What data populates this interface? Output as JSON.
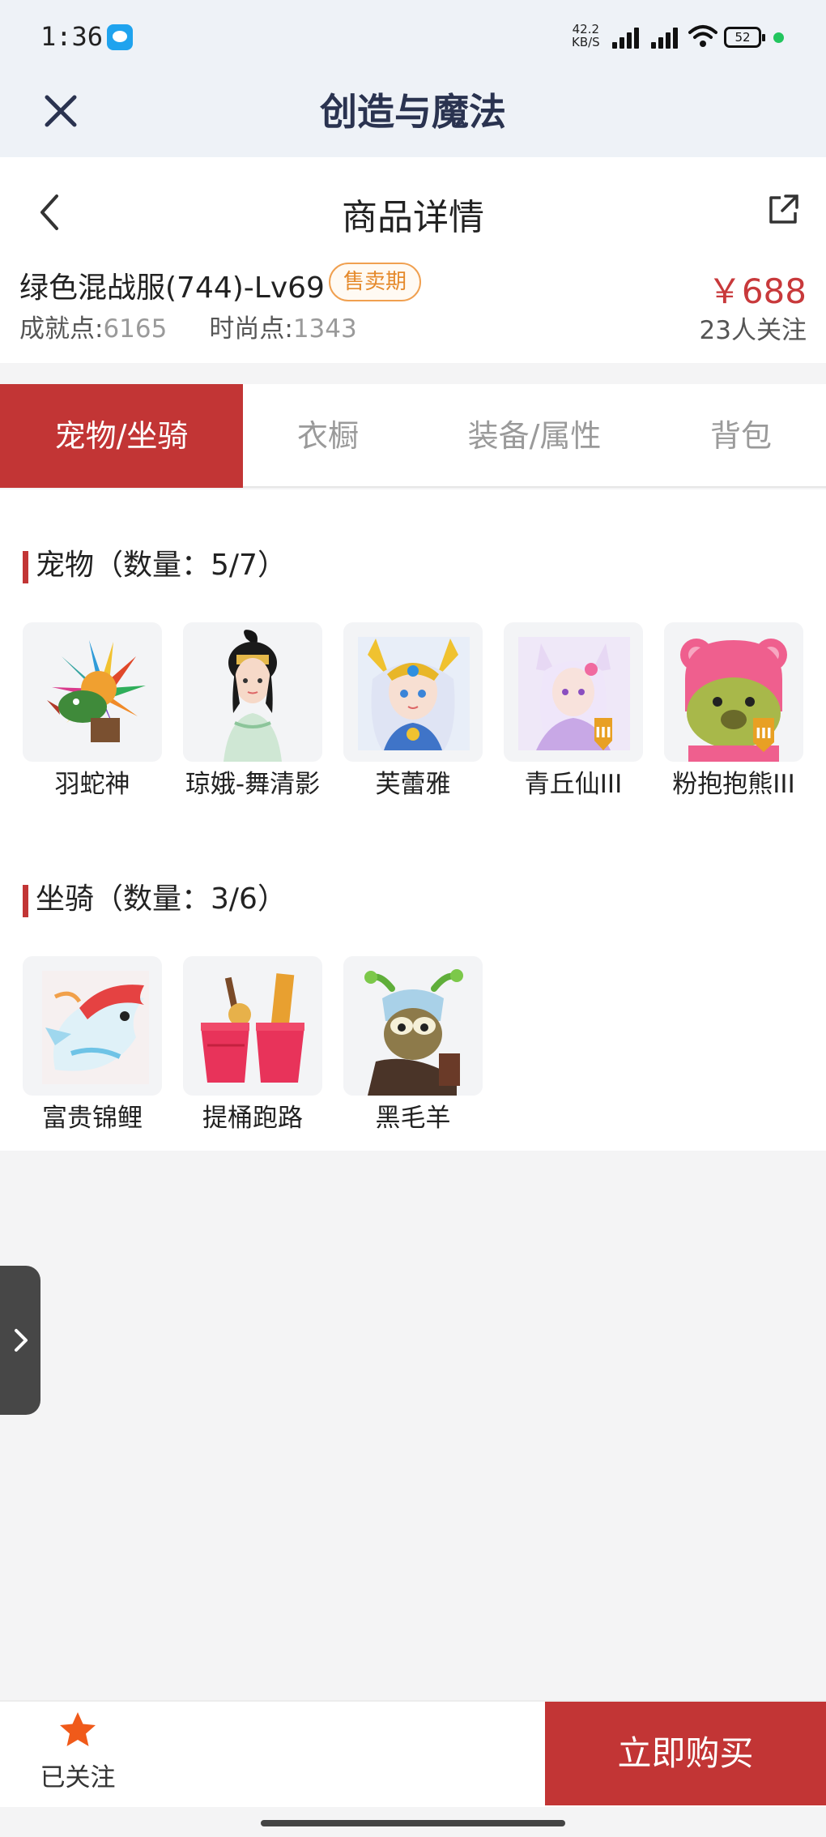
{
  "status_bar": {
    "time": "1:36",
    "speed_value": "42.2",
    "speed_unit": "KB/S",
    "battery": "52"
  },
  "header": {
    "title": "创造与魔法",
    "close_icon": "close-icon"
  },
  "nav": {
    "title": "商品详情",
    "back_icon": "chevron-left-icon",
    "share_icon": "share-icon"
  },
  "product": {
    "name": "绿色混战服(744)-Lv69",
    "badge": "售卖期",
    "price": "￥688",
    "achievement_label": "成就点:",
    "achievement_value": "6165",
    "fashion_label": "时尚点:",
    "fashion_value": "1343",
    "followers": "23人关注"
  },
  "tabs": [
    {
      "label": "宠物/坐骑",
      "active": true
    },
    {
      "label": "衣橱",
      "active": false
    },
    {
      "label": "装备/属性",
      "active": false
    },
    {
      "label": "背包",
      "active": false
    }
  ],
  "pets": {
    "title": "宠物（数量：5/7）",
    "items": [
      {
        "name": "羽蛇神"
      },
      {
        "name": "琼娥-舞清影"
      },
      {
        "name": "芙蕾雅"
      },
      {
        "name": "青丘仙III"
      },
      {
        "name": "粉抱抱熊III"
      }
    ]
  },
  "mounts": {
    "title": "坐骑（数量：3/6）",
    "items": [
      {
        "name": "富贵锦鲤"
      },
      {
        "name": "提桶跑路"
      },
      {
        "name": "黑毛羊"
      }
    ]
  },
  "bottom": {
    "follow_label": "已关注",
    "buy_label": "立即购买"
  },
  "colors": {
    "accent": "#c23535",
    "badge": "#e58a2c",
    "star": "#f05a1a"
  }
}
